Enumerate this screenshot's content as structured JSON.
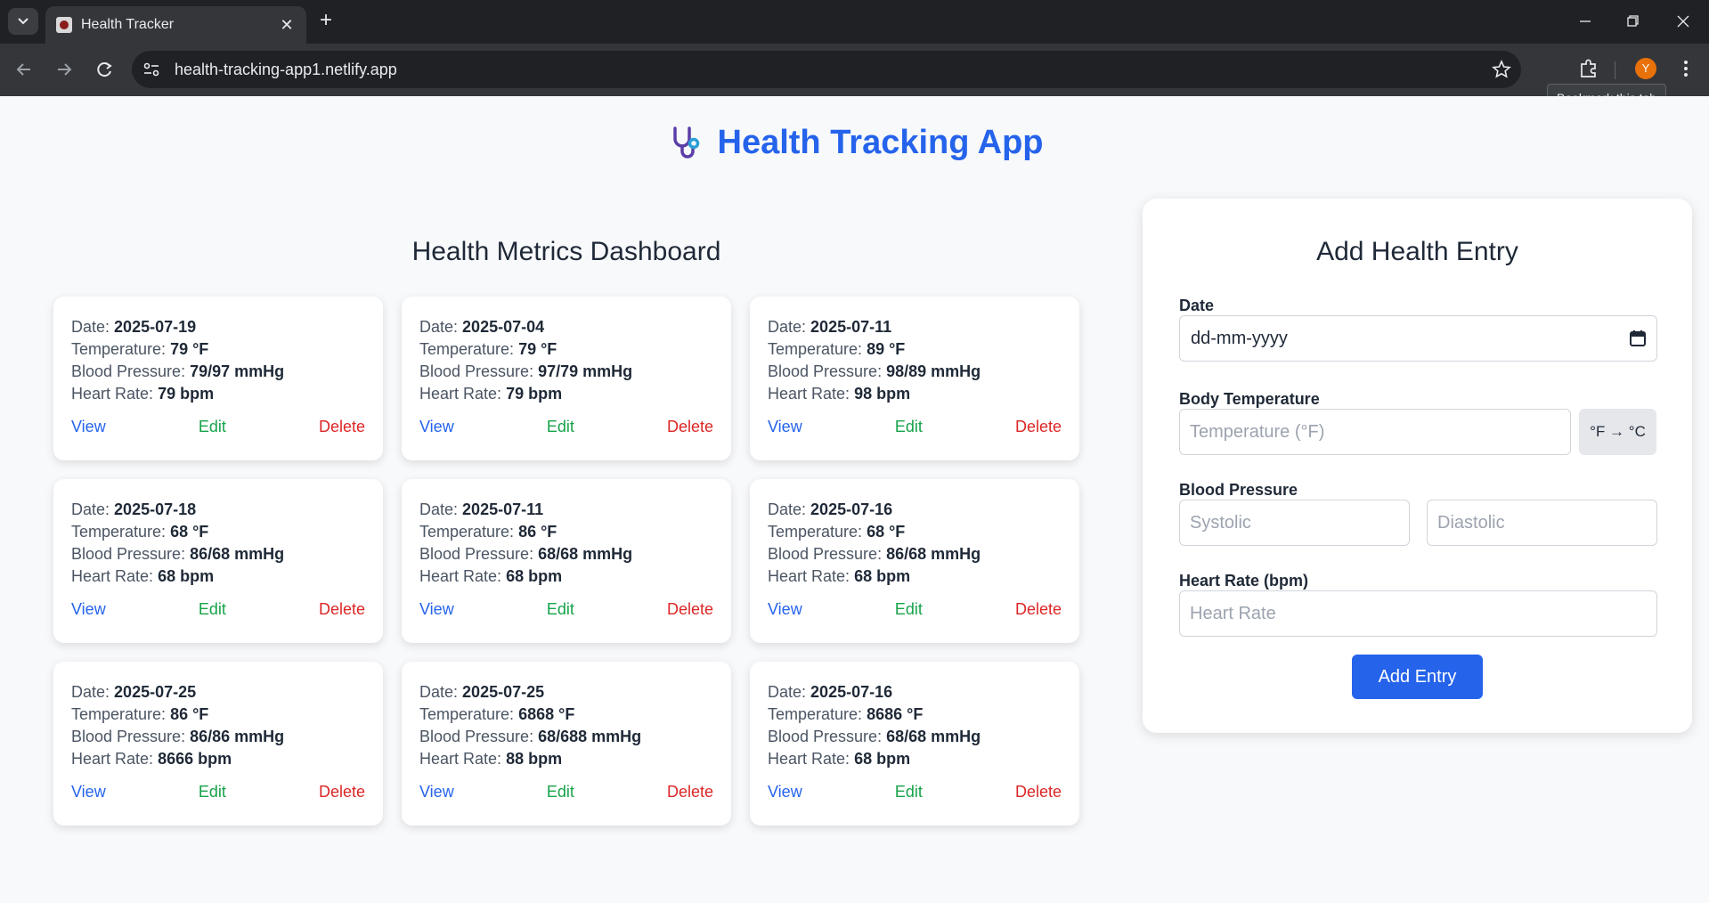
{
  "browser": {
    "tab_title": "Health Tracker",
    "url": "health-tracking-app1.netlify.app",
    "profile_initial": "Y",
    "tooltip": "Bookmark this tab"
  },
  "app": {
    "title": "Health Tracking App",
    "logo_icon": "stethoscope-icon"
  },
  "dashboard": {
    "title": "Health Metrics Dashboard",
    "labels": {
      "date": "Date:",
      "temperature": "Temperature:",
      "blood_pressure": "Blood Pressure:",
      "heart_rate": "Heart Rate:"
    },
    "actions": {
      "view": "View",
      "edit": "Edit",
      "delete": "Delete"
    },
    "entries": [
      {
        "date": "2025-07-19",
        "temperature": "79 °F",
        "blood_pressure": "79/97 mmHg",
        "heart_rate": "79 bpm"
      },
      {
        "date": "2025-07-04",
        "temperature": "79 °F",
        "blood_pressure": "97/79 mmHg",
        "heart_rate": "79 bpm"
      },
      {
        "date": "2025-07-11",
        "temperature": "89 °F",
        "blood_pressure": "98/89 mmHg",
        "heart_rate": "98 bpm"
      },
      {
        "date": "2025-07-18",
        "temperature": "68 °F",
        "blood_pressure": "86/68 mmHg",
        "heart_rate": "68 bpm"
      },
      {
        "date": "2025-07-11",
        "temperature": "86 °F",
        "blood_pressure": "68/68 mmHg",
        "heart_rate": "68 bpm"
      },
      {
        "date": "2025-07-16",
        "temperature": "68 °F",
        "blood_pressure": "86/68 mmHg",
        "heart_rate": "68 bpm"
      },
      {
        "date": "2025-07-25",
        "temperature": "86 °F",
        "blood_pressure": "86/86 mmHg",
        "heart_rate": "8666 bpm"
      },
      {
        "date": "2025-07-25",
        "temperature": "6868 °F",
        "blood_pressure": "68/688 mmHg",
        "heart_rate": "88 bpm"
      },
      {
        "date": "2025-07-16",
        "temperature": "8686 °F",
        "blood_pressure": "68/68 mmHg",
        "heart_rate": "68 bpm"
      }
    ]
  },
  "form": {
    "title": "Add Health Entry",
    "date_label": "Date",
    "date_value": "dd-mm-yyyy",
    "temperature_label": "Body Temperature",
    "temperature_placeholder": "Temperature (°F)",
    "convert_label": "°F → °C",
    "bp_label": "Blood Pressure",
    "systolic_placeholder": "Systolic",
    "diastolic_placeholder": "Diastolic",
    "heart_rate_label": "Heart Rate (bpm)",
    "heart_rate_placeholder": "Heart Rate",
    "submit_label": "Add Entry"
  },
  "colors": {
    "accent": "#2563eb",
    "view": "#2563eb",
    "edit": "#16a34a",
    "delete": "#dc2626"
  }
}
